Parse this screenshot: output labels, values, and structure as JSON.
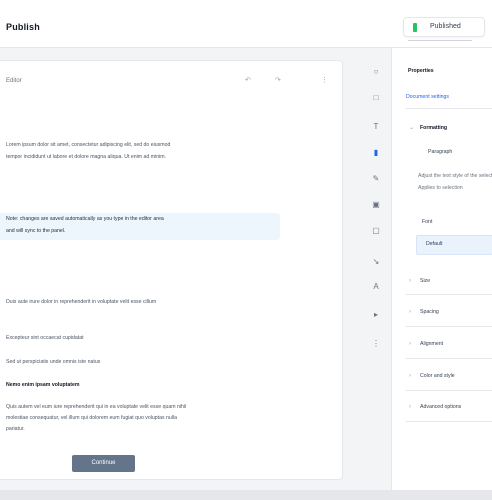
{
  "app": {
    "title": "Publish"
  },
  "topbar": {
    "publish_status": "Published"
  },
  "editor": {
    "header_label": "Editor",
    "tools": {
      "undo": "↶",
      "redo": "↷",
      "more": "⋮"
    },
    "lines": [
      "Lorem ipsum dolor sit amet, consectetur adipiscing elit, sed do eiusmod",
      "tempor incididunt ut labore et dolore magna aliqua. Ut enim ad minim.",
      "Note: changes are saved automatically as you type in the editor area",
      "and will sync to the panel.",
      "Duis aute irure dolor in reprehenderit in voluptate velit esse cillum",
      "Excepteur sint occaecat cupidatat",
      "Sed ut perspiciatis unde omnis iste natus",
      "Nemo enim ipsam voluptatem",
      "Quis autem vel eum iure reprehenderit qui in ea voluptate velit esse quam nihil",
      "molestiae consequatur, vel illum qui dolorem eum fugiat quo voluptas nulla",
      "pariatur."
    ],
    "cta_label": "Continue"
  },
  "rail": {
    "items": [
      {
        "glyph": "○",
        "icon": "circle-icon"
      },
      {
        "glyph": "□",
        "icon": "square-icon"
      },
      {
        "glyph": "T",
        "icon": "text-icon"
      },
      {
        "glyph": "▮",
        "icon": "block-icon"
      },
      {
        "glyph": "✎",
        "icon": "pencil-icon"
      },
      {
        "glyph": "▣",
        "icon": "image-icon"
      },
      {
        "glyph": "▢",
        "icon": "frame-icon"
      },
      {
        "glyph": "↘",
        "icon": "arrow-icon"
      },
      {
        "glyph": "A",
        "icon": "font-icon"
      },
      {
        "glyph": "▸",
        "icon": "play-icon"
      },
      {
        "glyph": "⋮",
        "icon": "more-icon"
      }
    ]
  },
  "panel": {
    "title": "Properties",
    "link": "Document settings",
    "section1_title": "Formatting",
    "section1_value": "Paragraph",
    "description": "Adjust the text style of the selected block.",
    "description2": "Applies to selection",
    "field_label": "Font",
    "field_value": "Default",
    "rows": [
      "Size",
      "Spacing",
      "Alignment",
      "Color and style",
      "Advanced options"
    ]
  },
  "colors": {
    "accent": "#2563eb",
    "status": "#22c55e",
    "cta": "#64748b"
  }
}
